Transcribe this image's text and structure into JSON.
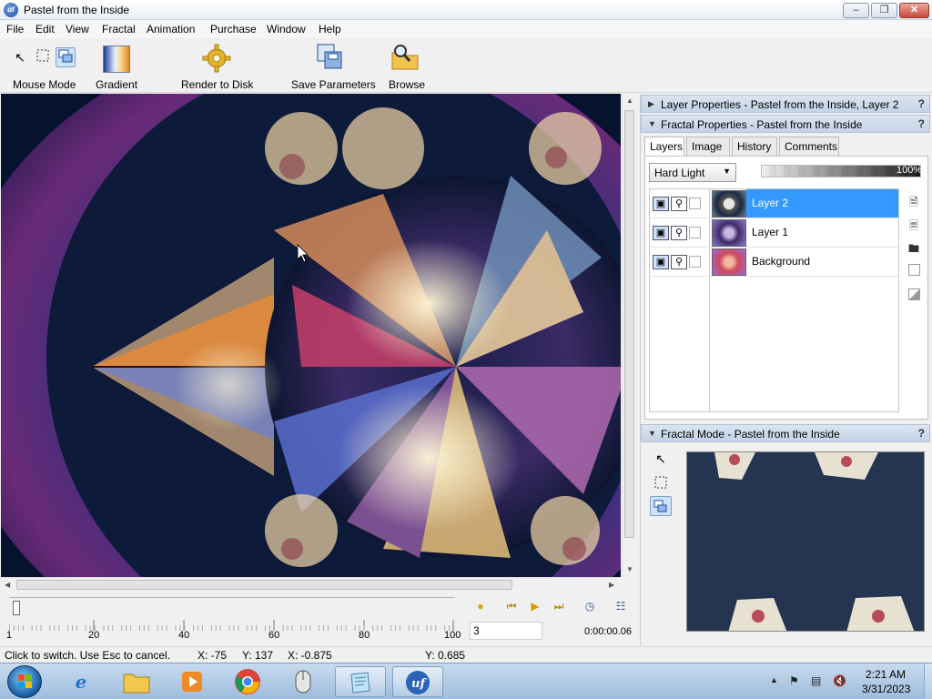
{
  "window": {
    "title": "Pastel from the Inside",
    "app_icon": "uf"
  },
  "menu": [
    "File",
    "Edit",
    "View",
    "Fractal",
    "Animation",
    "Purchase",
    "Window",
    "Help"
  ],
  "toolbar": {
    "mouse_mode_label": "Mouse Mode",
    "gradient_label": "Gradient",
    "render_label": "Render to Disk",
    "save_params_label": "Save Parameters",
    "browse_label": "Browse"
  },
  "right_panel": {
    "layer_properties_header": "Layer Properties - Pastel from the Inside, Layer 2",
    "fractal_properties_header": "Fractal Properties - Pastel from the Inside",
    "tabs": [
      "Layers",
      "Image",
      "History",
      "Comments"
    ],
    "active_tab": "Layers",
    "blend_mode": "Hard Light",
    "opacity": {
      "value": 1.0,
      "label": "100%"
    },
    "layers": [
      {
        "name": "Layer 2",
        "selected": true
      },
      {
        "name": "Layer 1",
        "selected": false
      },
      {
        "name": "Background",
        "selected": false
      }
    ],
    "fractal_mode_header": "Fractal Mode - Pastel from the Inside",
    "help_glyph": "?"
  },
  "timeline": {
    "tick_labels": [
      "1",
      "20",
      "40",
      "60",
      "80",
      "100"
    ],
    "frame_value": "3",
    "time": "0:00:00.06"
  },
  "status": {
    "message": "Click to switch. Use Esc to cancel.",
    "px": "X: -75",
    "py": "Y: 137",
    "fx": "X: -0.875",
    "fy": "Y: 0.685"
  },
  "taskbar": {
    "apps": [
      "internet-explorer",
      "file-explorer",
      "media-player",
      "chrome",
      "mouse-app",
      "notepad-app",
      "ultra-fractal"
    ],
    "time": "2:21 AM",
    "date": "3/31/2023"
  },
  "colors": {
    "selection": "#3399ff",
    "panel_header": "#c4d3e6"
  }
}
